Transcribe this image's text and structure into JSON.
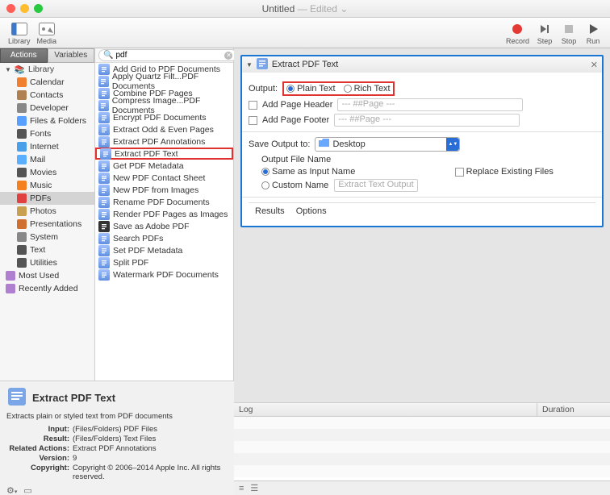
{
  "title": {
    "name": "Untitled",
    "edited": "— Edited"
  },
  "toolbar": {
    "left": [
      {
        "label": "Library",
        "name": "library-toggle"
      },
      {
        "label": "Media",
        "name": "media-toggle"
      }
    ],
    "right": [
      {
        "label": "Record",
        "name": "record-button"
      },
      {
        "label": "Step",
        "name": "step-button"
      },
      {
        "label": "Stop",
        "name": "stop-button"
      },
      {
        "label": "Run",
        "name": "run-button"
      }
    ]
  },
  "sidebar": {
    "tabs": {
      "actions": "Actions",
      "variables": "Variables"
    },
    "library_label": "Library",
    "items": [
      "Calendar",
      "Contacts",
      "Developer",
      "Files & Folders",
      "Fonts",
      "Internet",
      "Mail",
      "Movies",
      "Music",
      "PDFs",
      "Photos",
      "Presentations",
      "System",
      "Text",
      "Utilities"
    ],
    "selected_index": 9,
    "footer": [
      "Most Used",
      "Recently Added"
    ]
  },
  "search": {
    "query": "pdf"
  },
  "actions": [
    "Add Grid to PDF Documents",
    "Apply Quartz Filt...PDF Documents",
    "Combine PDF Pages",
    "Compress Image...PDF Documents",
    "Encrypt PDF Documents",
    "Extract Odd & Even Pages",
    "Extract PDF Annotations",
    "Extract PDF Text",
    "Get PDF Metadata",
    "New PDF Contact Sheet",
    "New PDF from Images",
    "Rename PDF Documents",
    "Render PDF Pages as Images",
    "Save as Adobe PDF",
    "Search PDFs",
    "Set PDF Metadata",
    "Split PDF",
    "Watermark PDF Documents"
  ],
  "actions_selected_index": 7,
  "workflow": {
    "step_title": "Extract PDF Text",
    "output_label": "Output:",
    "output_options": {
      "plain": "Plain Text",
      "rich": "Rich Text"
    },
    "add_header": "Add Page Header",
    "add_footer": "Add Page Footer",
    "page_placeholder": "--- ##Page ---",
    "save_output": "Save Output to:",
    "save_location": "Desktop",
    "filename_section": "Output File Name",
    "same_name": "Same as Input Name",
    "custom_name": "Custom Name",
    "custom_placeholder": "Extract Text Output",
    "replace": "Replace Existing Files",
    "tabs": {
      "results": "Results",
      "options": "Options"
    }
  },
  "description": {
    "title": "Extract PDF Text",
    "summary": "Extracts plain or styled text from PDF documents",
    "rows": [
      {
        "k": "Input:",
        "v": "(Files/Folders) PDF Files"
      },
      {
        "k": "Result:",
        "v": "(Files/Folders) Text Files"
      },
      {
        "k": "Related Actions:",
        "v": "Extract PDF Annotations"
      },
      {
        "k": "Version:",
        "v": "9"
      },
      {
        "k": "Copyright:",
        "v": "Copyright © 2006–2014 Apple Inc. All rights reserved."
      }
    ]
  },
  "log": {
    "col_log": "Log",
    "col_dur": "Duration"
  }
}
